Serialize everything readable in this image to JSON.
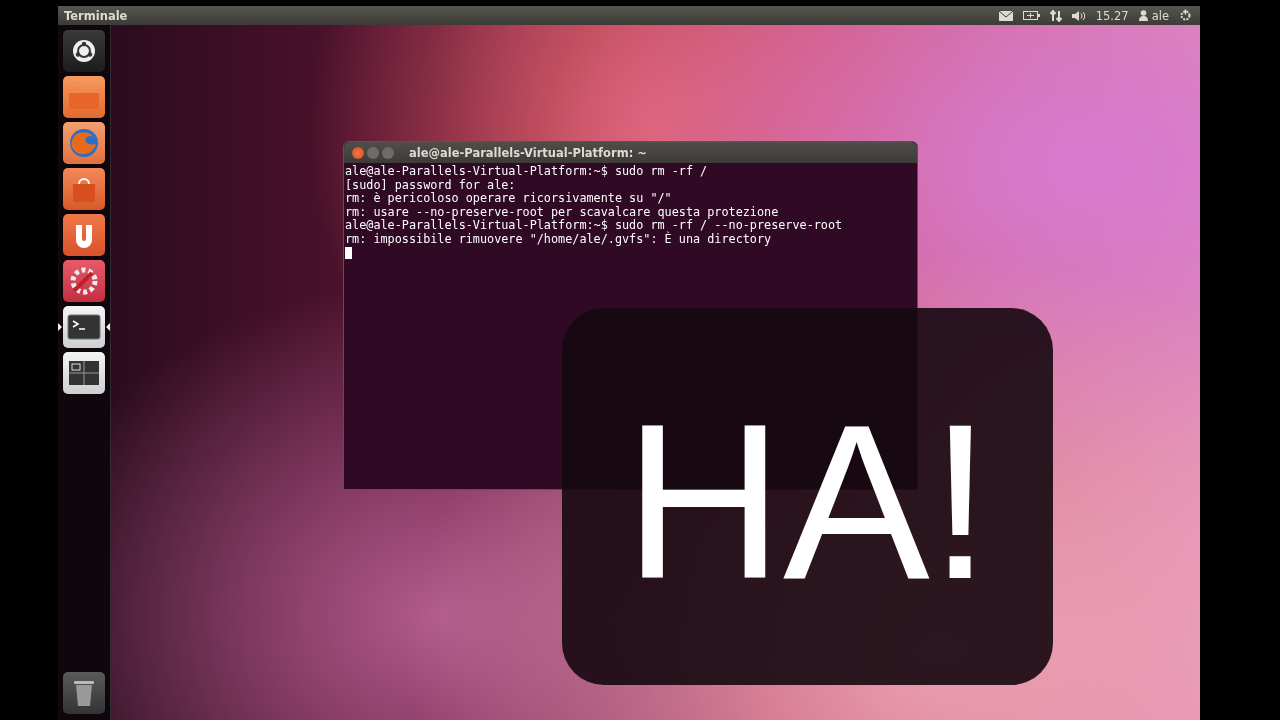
{
  "top_bar": {
    "app_title": "Terminale",
    "clock": "15.27",
    "user": "ale"
  },
  "launcher": [
    {
      "kind": "home",
      "active": false
    },
    {
      "kind": "files",
      "active": false
    },
    {
      "kind": "browser",
      "active": false
    },
    {
      "kind": "software",
      "active": false
    },
    {
      "kind": "cloud",
      "active": false
    },
    {
      "kind": "settings",
      "active": false
    },
    {
      "kind": "terminal",
      "active": true
    },
    {
      "kind": "workspaces",
      "active": false
    },
    {
      "kind": "trash",
      "active": false
    }
  ],
  "terminal": {
    "title": "ale@ale-Parallels-Virtual-Platform: ~",
    "lines": [
      "ale@ale-Parallels-Virtual-Platform:~$ sudo rm -rf /",
      "[sudo] password for ale:",
      "rm: è pericoloso operare ricorsivamente su \"/\"",
      "rm: usare --no-preserve-root per scavalcare questa protezione",
      "ale@ale-Parallels-Virtual-Platform:~$ sudo rm -rf / --no-preserve-root",
      "rm: impossibile rimuovere \"/home/ale/.gvfs\": È una directory"
    ]
  },
  "overlay": {
    "text": "HA!"
  }
}
